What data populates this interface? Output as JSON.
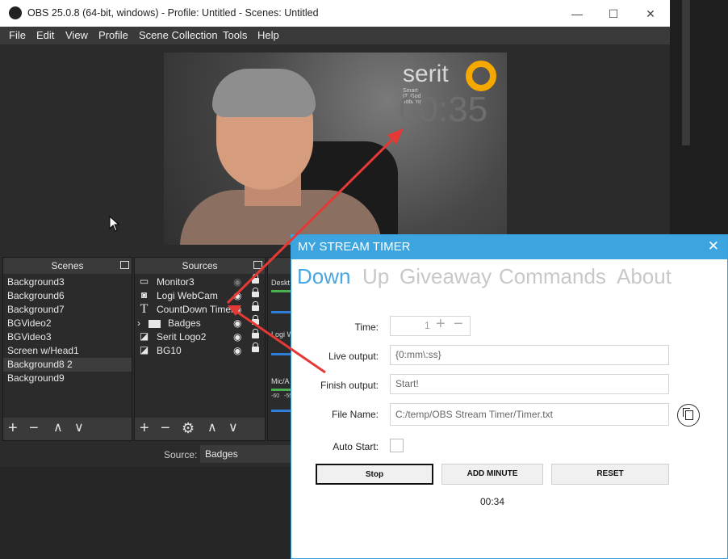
{
  "obs": {
    "title": "OBS 25.0.8 (64-bit, windows) - Profile: Untitled - Scenes: Untitled",
    "window_controls": [
      "—",
      "☐",
      "✕"
    ],
    "menu": [
      "File",
      "Edit",
      "View",
      "Profile",
      "Scene Collection",
      "Tools",
      "Help"
    ],
    "preview": {
      "logo_text": "serit",
      "logo_tagline": "Smart IT. God Jobbing",
      "timer": "00:35"
    },
    "scenes": {
      "header": "Scenes",
      "items": [
        "Background3",
        "Background6",
        "Background7",
        "BGVideo2",
        "BGVideo3",
        "Screen w/Head1",
        "Background8 2",
        "Background9"
      ],
      "selected_index": 6
    },
    "sources": {
      "header": "Sources",
      "items": [
        {
          "label": "Monitor3",
          "icon": "monitor-icon"
        },
        {
          "label": "Logi WebCam",
          "icon": "camera-icon"
        },
        {
          "label": "CountDown Timer",
          "icon": "text-icon"
        },
        {
          "label": "Badges",
          "icon": "folder-icon"
        },
        {
          "label": "Serit Logo2",
          "icon": "image-icon"
        },
        {
          "label": "BG10",
          "icon": "image-icon"
        }
      ]
    },
    "mixer_partial": [
      "Deskt",
      "Logi W",
      "Mic/A"
    ],
    "mixer_ticks": [
      "-60",
      "-55"
    ],
    "filter_source_label": "Source:",
    "filter_source_value": "Badges"
  },
  "timer_window": {
    "title": "MY STREAM TIMER",
    "close": "✕",
    "tabs": [
      "Down",
      "Up",
      "Giveaway",
      "Commands",
      "About"
    ],
    "active_tab": "Down",
    "fields": {
      "time_label": "Time:",
      "time_value": "1",
      "live_output_label": "Live output:",
      "live_output_value": "{0:mm\\:ss}",
      "finish_output_label": "Finish output:",
      "finish_output_value": "Start!",
      "file_name_label": "File Name:",
      "file_name_value": "C:/temp/OBS Stream Timer/Timer.txt",
      "auto_start_label": "Auto Start:"
    },
    "buttons": {
      "stop": "Stop",
      "add_minute": "ADD MINUTE",
      "reset": "RESET"
    },
    "current_time": "00:34"
  },
  "colors": {
    "accent": "#3ca4df",
    "annotation_arrow": "#e53935",
    "logo_ring": "#f5a800"
  }
}
